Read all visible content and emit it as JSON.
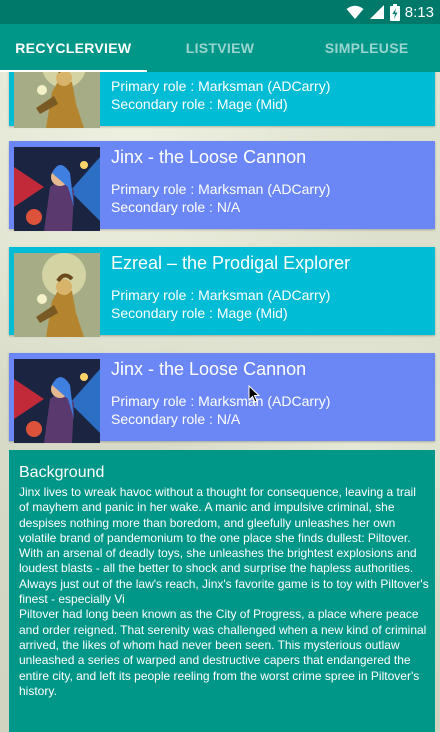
{
  "status_bar": {
    "time": "8:13",
    "icons": [
      "wifi-icon",
      "signal-icon",
      "battery-icon"
    ]
  },
  "tabs": [
    {
      "label": "RECYCLERVIEW",
      "active": true
    },
    {
      "label": "LISTVIEW",
      "active": false
    },
    {
      "label": "SIMPLEUSE",
      "active": false
    }
  ],
  "cards": [
    {
      "title": "",
      "primary": "Primary role : Marksman (ADCarry)",
      "secondary": "Secondary role : Mage (Mid)",
      "color": "#00bcd4",
      "image": "ezreal-portrait"
    },
    {
      "title": "Jinx - the Loose Cannon",
      "primary": "Primary role : Marksman (ADCarry)",
      "secondary": "Secondary role : N/A",
      "color": "#6b87f5",
      "image": "jinx-portrait"
    },
    {
      "title": "Ezreal – the Prodigal Explorer",
      "primary": "Primary role : Marksman (ADCarry)",
      "secondary": "Secondary role : Mage (Mid)",
      "color": "#00bcd4",
      "image": "ezreal-portrait"
    },
    {
      "title": "Jinx - the Loose Cannon",
      "primary": "Primary role : Marksman (ADCarry)",
      "secondary": "Secondary role : N/A",
      "color": "#6b87f5",
      "image": "jinx-portrait"
    }
  ],
  "detail": {
    "heading": "Background",
    "body": "Jinx lives to wreak havoc without a thought for consequence, leaving a trail of mayhem and panic in her wake. A manic and impulsive criminal, she despises nothing more than boredom, and gleefully unleashes her own volatile brand of pandemonium to the one place she finds dullest: Piltover. With an arsenal of deadly toys, she unleashes the brightest explosions and loudest blasts - all the better to shock and surprise the hapless authorities. Always just out of the law's reach, Jinx's favorite game is to toy with Piltover's finest - especially Vi\n Piltover had long been known as the City of Progress, a place where peace and order reigned. That serenity was challenged when a new kind of criminal arrived, the likes of whom had never been seen. This mysterious outlaw unleashed a series of warped and destructive capers that endangered the entire city, and left its people reeling from the worst crime spree in Piltover's history.",
    "color": "#009688"
  },
  "colors": {
    "status_bar": "#00796b",
    "app_bar": "#009688"
  }
}
